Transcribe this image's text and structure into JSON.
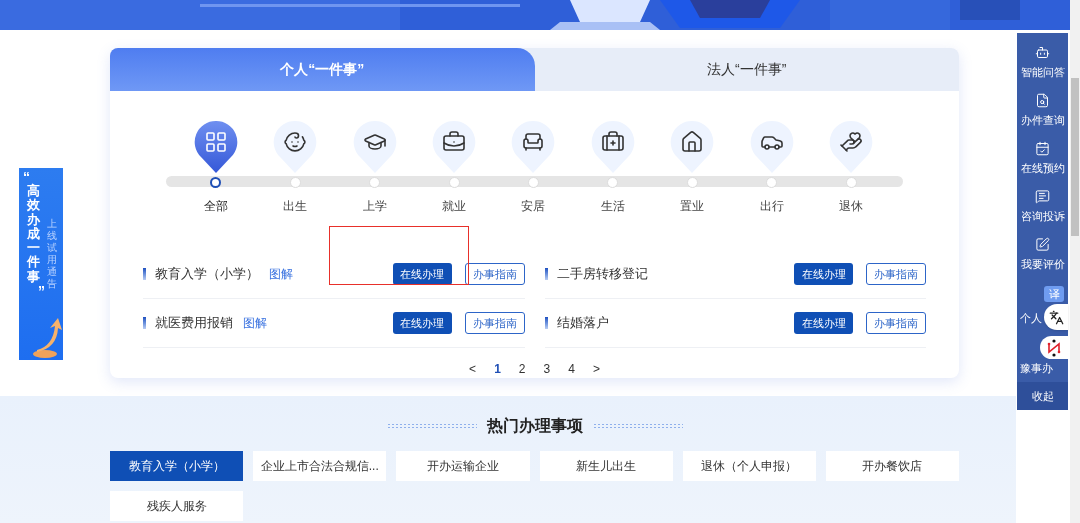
{
  "tabs": [
    {
      "label": "个人“一件事”",
      "selected": true
    },
    {
      "label": "法人“一件事”",
      "selected": false
    }
  ],
  "categories": [
    {
      "label": "全部",
      "selected": true
    },
    {
      "label": "出生",
      "selected": false
    },
    {
      "label": "上学",
      "selected": false
    },
    {
      "label": "就业",
      "selected": false
    },
    {
      "label": "安居",
      "selected": false
    },
    {
      "label": "生活",
      "selected": false
    },
    {
      "label": "置业",
      "selected": false
    },
    {
      "label": "出行",
      "selected": false
    },
    {
      "label": "退休",
      "selected": false
    }
  ],
  "services": [
    {
      "title": "教育入学（小学）",
      "diagram_link": "图解",
      "online_button": "在线办理",
      "guide_button": "办事指南"
    },
    {
      "title": "二手房转移登记",
      "online_button": "在线办理",
      "guide_button": "办事指南"
    },
    {
      "title": "就医费用报销",
      "diagram_link": "图解",
      "online_button": "在线办理",
      "guide_button": "办事指南"
    },
    {
      "title": "结婚落户",
      "online_button": "在线办理",
      "guide_button": "办事指南"
    }
  ],
  "pagination": {
    "prev": "<",
    "next": ">",
    "pages": [
      {
        "label": "1",
        "selected": true
      },
      {
        "label": "2",
        "selected": false
      },
      {
        "label": "3",
        "selected": false
      },
      {
        "label": "4",
        "selected": false
      }
    ]
  },
  "hot_section": {
    "title": "热门办理事项",
    "items": [
      {
        "label": "教育入学（小学）",
        "selected": true
      },
      {
        "label": "企业上市合法合规信...",
        "selected": false
      },
      {
        "label": "开办运输企业",
        "selected": false
      },
      {
        "label": "新生儿出生",
        "selected": false
      },
      {
        "label": "退休（个人申报）",
        "selected": false
      },
      {
        "label": "开办餐饮店",
        "selected": false
      },
      {
        "label": "残疾人服务",
        "selected": false
      }
    ]
  },
  "side_ad": {
    "open_quote": "“",
    "headline": "高效办成一件事",
    "close_quote": "”",
    "subline": "上线试用通告"
  },
  "sidebar": {
    "items": [
      "智能问答",
      "办件查询",
      "在线预约",
      "咨询投诉",
      "我要评价",
      "个人",
      "豫事办"
    ],
    "collapse": "收起"
  },
  "translate_badge": "译"
}
